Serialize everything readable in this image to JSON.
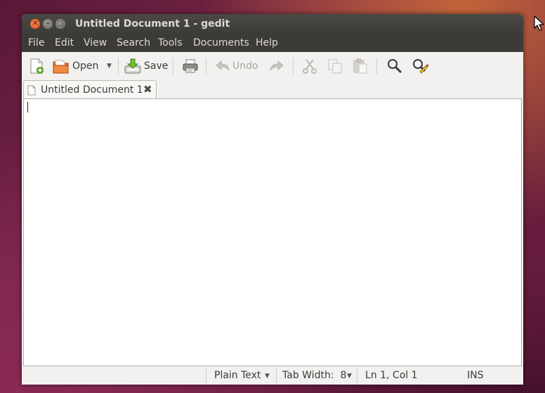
{
  "window": {
    "title": "Untitled Document 1 - gedit"
  },
  "menu": [
    "File",
    "Edit",
    "View",
    "Search",
    "Tools",
    "Documents",
    "Help"
  ],
  "toolbar": {
    "open_label": "Open",
    "save_label": "Save",
    "undo_label": "Undo"
  },
  "tab": {
    "label": "Untitled Document 1"
  },
  "editor": {
    "content": ""
  },
  "statusbar": {
    "language": "Plain Text",
    "tab_width": "Tab Width:  8",
    "position": "Ln 1, Col 1",
    "mode": "INS"
  },
  "colors": {
    "titlebar": "#3c3b37",
    "close_button": "#de4a14",
    "window_bg": "#f2f1f0"
  }
}
